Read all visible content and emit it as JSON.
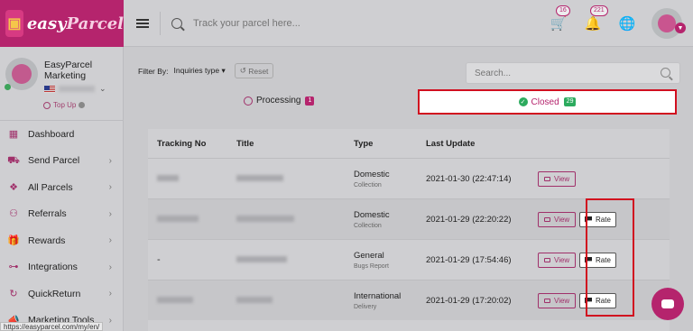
{
  "brand": {
    "name_part1": "easy",
    "name_part2": "Parcel"
  },
  "topbar": {
    "search_placeholder": "Track your parcel here...",
    "cart_count": "16",
    "notification_count": "221"
  },
  "profile": {
    "name": "EasyParcel Marketing",
    "topup_label": "Top Up"
  },
  "sidebar": {
    "items": [
      {
        "label": "Dashboard",
        "icon": "dashboard-icon",
        "has_arrow": false
      },
      {
        "label": "Send Parcel",
        "icon": "truck-icon",
        "has_arrow": true
      },
      {
        "label": "All Parcels",
        "icon": "parcels-icon",
        "has_arrow": true
      },
      {
        "label": "Referrals",
        "icon": "referral-icon",
        "has_arrow": true
      },
      {
        "label": "Rewards",
        "icon": "gift-icon",
        "has_arrow": true
      },
      {
        "label": "Integrations",
        "icon": "link-icon",
        "has_arrow": true
      },
      {
        "label": "QuickReturn",
        "icon": "return-icon",
        "has_arrow": true
      },
      {
        "label": "Marketing Tools",
        "icon": "megaphone-icon",
        "has_arrow": true
      }
    ]
  },
  "status_url": "https://easyparcel.com/my/en/",
  "filter": {
    "label": "Filter By:",
    "selected": "Inquiries type",
    "reset_label": "Reset"
  },
  "search": {
    "placeholder": "Search..."
  },
  "tabs": {
    "processing": {
      "label": "Processing",
      "count": "1"
    },
    "closed": {
      "label": "Closed",
      "count": "29"
    }
  },
  "table": {
    "headers": [
      "Tracking No",
      "Title",
      "Type",
      "Last Update"
    ],
    "rows": [
      {
        "tracking": "",
        "title": "",
        "type": "Domestic",
        "subtype": "Collection",
        "updated": "2021-01-30 (22:47:14)",
        "view": "View",
        "rate": ""
      },
      {
        "tracking": "",
        "title": "",
        "type": "Domestic",
        "subtype": "Collection",
        "updated": "2021-01-29 (22:20:22)",
        "view": "View",
        "rate": "Rate"
      },
      {
        "tracking": "-",
        "title": "",
        "type": "General",
        "subtype": "Bugs Report",
        "updated": "2021-01-29 (17:54:46)",
        "view": "View",
        "rate": "Rate"
      },
      {
        "tracking": "",
        "title": "",
        "type": "International",
        "subtype": "Delivery",
        "updated": "2021-01-29 (17:20:02)",
        "view": "View",
        "rate": "Rate"
      }
    ]
  },
  "colors": {
    "brand": "#b5246d",
    "highlight": "#d10f1f",
    "success": "#2cab5e"
  }
}
